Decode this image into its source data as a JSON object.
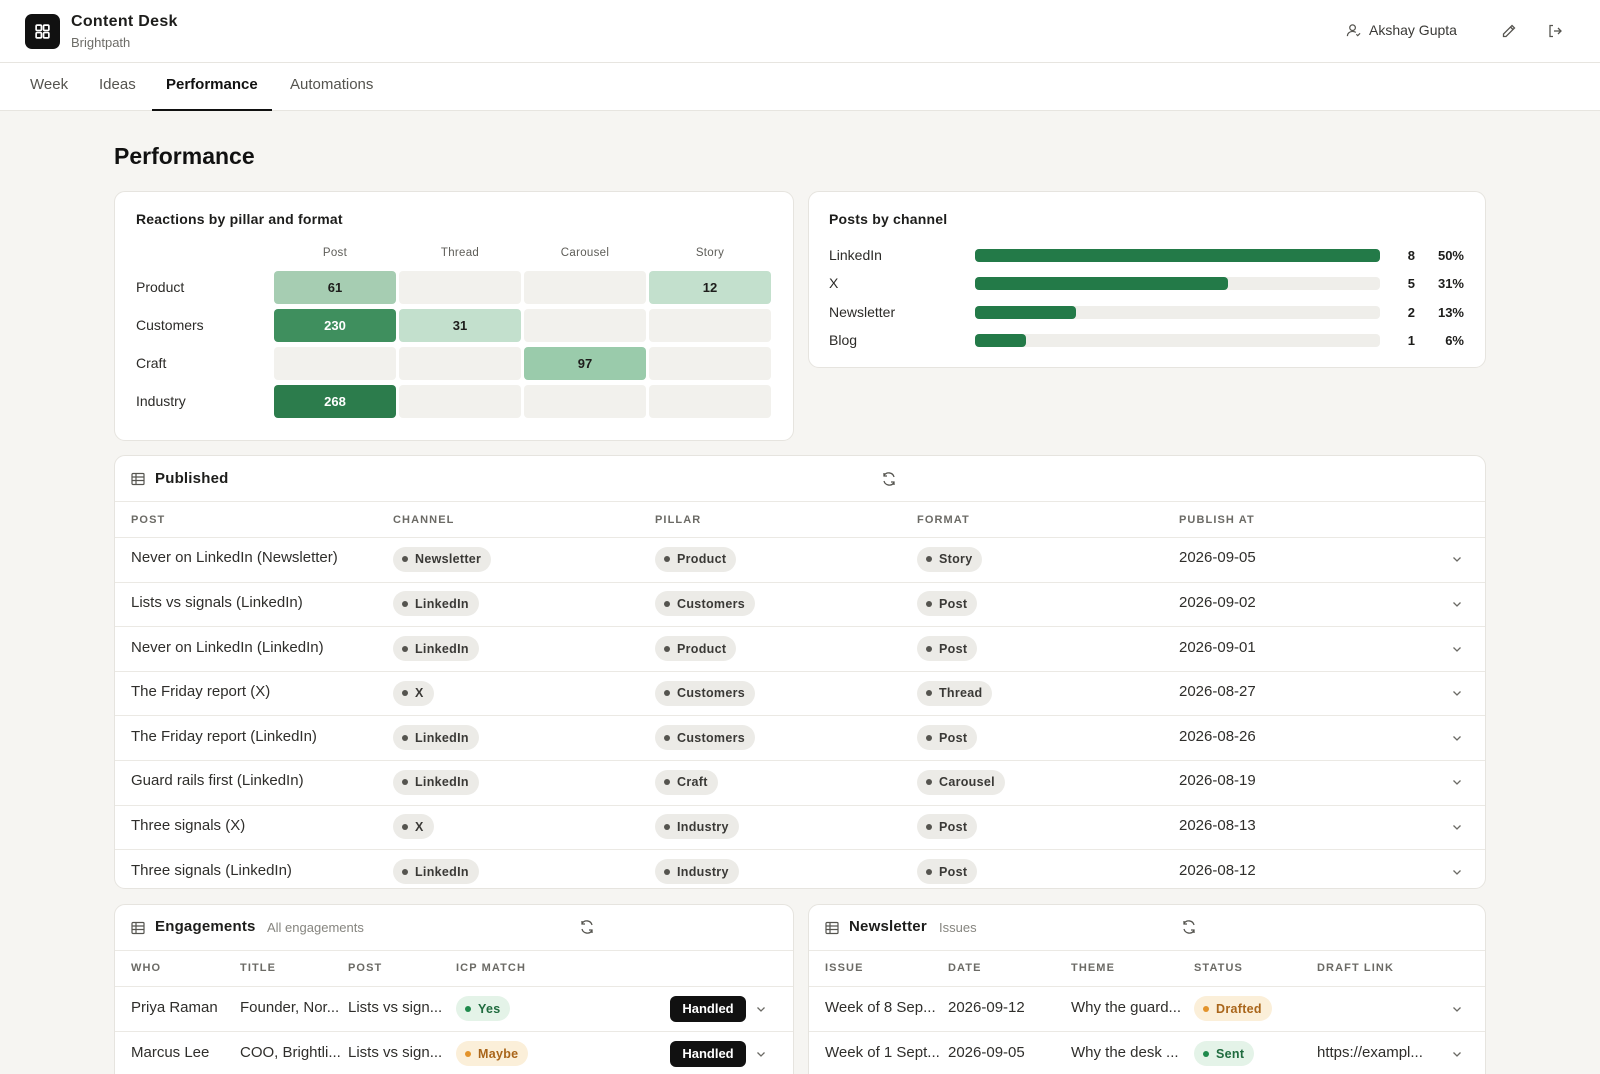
{
  "app": {
    "title": "Content Desk",
    "workspace": "Brightpath",
    "user": "Akshay Gupta"
  },
  "tabs": [
    "Week",
    "Ideas",
    "Performance",
    "Automations"
  ],
  "page_title": "Performance",
  "heatmap": {
    "title": "Reactions by pillar and format",
    "columns": [
      "Post",
      "Thread",
      "Carousel",
      "Story"
    ],
    "rows": [
      {
        "label": "Product",
        "cells": [
          "61",
          "",
          "",
          "12"
        ]
      },
      {
        "label": "Customers",
        "cells": [
          "230",
          "31",
          "",
          ""
        ]
      },
      {
        "label": "Craft",
        "cells": [
          "",
          "",
          "97",
          ""
        ]
      },
      {
        "label": "Industry",
        "cells": [
          "268",
          "",
          "",
          ""
        ]
      }
    ]
  },
  "channels": {
    "title": "Posts by channel",
    "items": [
      {
        "label": "LinkedIn",
        "count": "8",
        "pct": "50%",
        "fraction": 1.0
      },
      {
        "label": "X",
        "count": "5",
        "pct": "31%",
        "fraction": 0.625
      },
      {
        "label": "Newsletter",
        "count": "2",
        "pct": "13%",
        "fraction": 0.25
      },
      {
        "label": "Blog",
        "count": "1",
        "pct": "6%",
        "fraction": 0.125
      }
    ]
  },
  "published": {
    "title": "Published",
    "headers": [
      "POST",
      "CHANNEL",
      "PILLAR",
      "FORMAT",
      "PUBLISH AT"
    ],
    "rows": [
      {
        "post": "Never on LinkedIn (Newsletter)",
        "channel": "Newsletter",
        "pillar": "Product",
        "format": "Story",
        "date": "2026-09-05"
      },
      {
        "post": "Lists vs signals (LinkedIn)",
        "channel": "LinkedIn",
        "pillar": "Customers",
        "format": "Post",
        "date": "2026-09-02"
      },
      {
        "post": "Never on LinkedIn (LinkedIn)",
        "channel": "LinkedIn",
        "pillar": "Product",
        "format": "Post",
        "date": "2026-09-01"
      },
      {
        "post": "The Friday report (X)",
        "channel": "X",
        "pillar": "Customers",
        "format": "Thread",
        "date": "2026-08-27"
      },
      {
        "post": "The Friday report (LinkedIn)",
        "channel": "LinkedIn",
        "pillar": "Customers",
        "format": "Post",
        "date": "2026-08-26"
      },
      {
        "post": "Guard rails first (LinkedIn)",
        "channel": "LinkedIn",
        "pillar": "Craft",
        "format": "Carousel",
        "date": "2026-08-19"
      },
      {
        "post": "Three signals (X)",
        "channel": "X",
        "pillar": "Industry",
        "format": "Post",
        "date": "2026-08-13"
      },
      {
        "post": "Three signals (LinkedIn)",
        "channel": "LinkedIn",
        "pillar": "Industry",
        "format": "Post",
        "date": "2026-08-12"
      }
    ]
  },
  "engagements": {
    "title": "Engagements",
    "subtitle": "All engagements",
    "headers": [
      "WHO",
      "TITLE",
      "POST",
      "ICP MATCH"
    ],
    "rows": [
      {
        "who": "Priya Raman",
        "title": "Founder, Nor...",
        "post": "Lists vs sign...",
        "icp": "Yes",
        "status": "Handled"
      },
      {
        "who": "Marcus Lee",
        "title": "COO, Brightli...",
        "post": "Lists vs sign...",
        "icp": "Maybe",
        "status": "Handled"
      }
    ]
  },
  "newsletter": {
    "title": "Newsletter",
    "subtitle": "Issues",
    "headers": [
      "ISSUE",
      "DATE",
      "THEME",
      "STATUS",
      "DRAFT LINK"
    ],
    "rows": [
      {
        "issue": "Week of 8 Sep...",
        "date": "2026-09-12",
        "theme": "Why the guard...",
        "status": "Drafted",
        "link": ""
      },
      {
        "issue": "Week of 1 Sept...",
        "date": "2026-09-05",
        "theme": "Why the desk ...",
        "status": "Sent",
        "link": "https://exampl..."
      }
    ]
  }
}
